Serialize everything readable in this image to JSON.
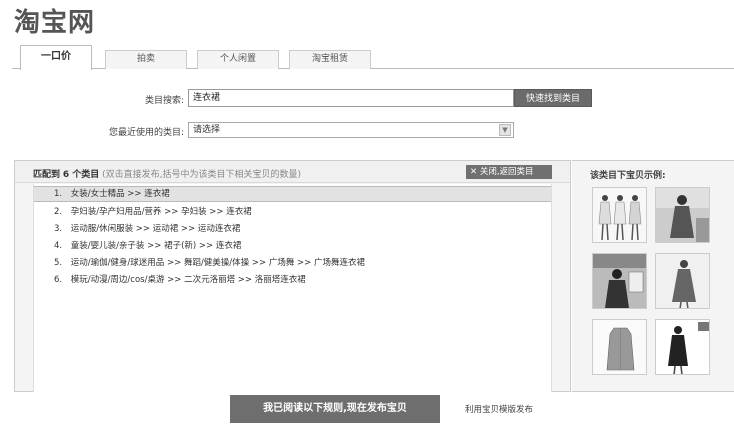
{
  "logo": {
    "text": "淘宝网"
  },
  "tabs": [
    {
      "label": "一口价",
      "active": true
    },
    {
      "label": "拍卖",
      "active": false
    },
    {
      "label": "个人闲置",
      "active": false
    },
    {
      "label": "淘宝租赁",
      "active": false
    }
  ],
  "search": {
    "label": "类目搜索:",
    "value": "连衣裙",
    "button_label": "快速找到类目"
  },
  "recent": {
    "label": "您最近使用的类目:",
    "selected": "请选择"
  },
  "match": {
    "prefix": "匹配到",
    "count_text": "6 个类目",
    "hint": "(双击直接发布,括号中为该类目下相关宝贝的数量)",
    "close_label": "关闭,返回类目",
    "items": [
      {
        "num": "1.",
        "path": "女装/女士精品 >> 连衣裙"
      },
      {
        "num": "2.",
        "path": "孕妇装/孕产妇用品/营养 >> 孕妇装 >> 连衣裙"
      },
      {
        "num": "3.",
        "path": "运动服/休闲服装 >> 运动裙 >> 运动连衣裙"
      },
      {
        "num": "4.",
        "path": "童装/婴儿装/亲子装 >> 裙子(新) >> 连衣裙"
      },
      {
        "num": "5.",
        "path": "运动/瑜伽/健身/球迷用品 >> 舞蹈/健美操/体操 >> 广场舞 >> 广场舞连衣裙"
      },
      {
        "num": "6.",
        "path": "模玩/动漫/周边/cos/桌游 >> 二次元洛丽塔 >> 洛丽塔连衣裙"
      }
    ]
  },
  "samples": {
    "title": "该类目下宝贝示例:",
    "thumbs": [
      "dress-sample-1",
      "dress-sample-2",
      "dress-sample-3",
      "dress-sample-4",
      "dress-sample-5",
      "dress-sample-6"
    ]
  },
  "publish": {
    "button_label": "我已阅读以下规则,现在发布宝贝",
    "template_link": "利用宝贝模版发布"
  },
  "colors": {
    "button_gray": "#6b6b6b",
    "panel_bg": "#f4f4f4",
    "selected_row": "#e2e2e2"
  }
}
